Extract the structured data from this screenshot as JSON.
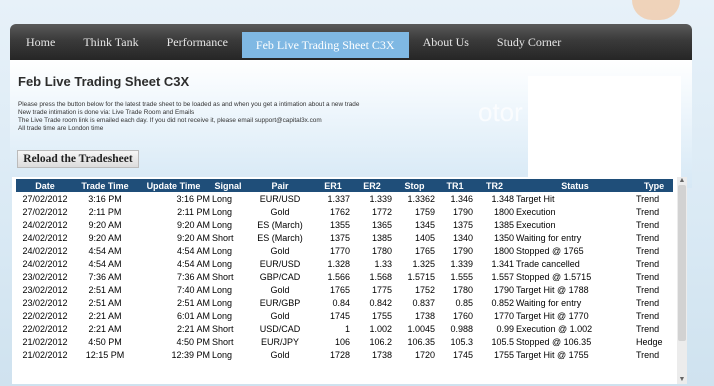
{
  "nav": {
    "items": [
      "Home",
      "Think Tank",
      "Performance",
      "Feb Live Trading Sheet C3X",
      "About Us",
      "Study Corner"
    ],
    "active_index": 3
  },
  "page": {
    "title": "Feb Live Trading Sheet C3X",
    "intro_lines": [
      "Please press the button below for the latest trade sheet to be loaded as and when you get a intimation about a new trade",
      "New trade intimation is done via: Live Trade Room and Emails",
      "The Live Trade room link is emailed each day. If you did not receive it, please email support@capital3x.com",
      "All trade time are London time"
    ],
    "reload_label": "Reload the Tradesheet",
    "watermark": "otor"
  },
  "table": {
    "headers": [
      "Date",
      "Trade Time",
      "Update Time",
      "Signal",
      "Pair",
      "ER1",
      "ER2",
      "Stop",
      "TR1",
      "TR2",
      "Status",
      "Type"
    ],
    "rows": [
      [
        "27/02/2012",
        "3:16 PM",
        "3:16 PM",
        "Long",
        "EUR/USD",
        "1.337",
        "1.339",
        "1.3362",
        "1.346",
        "1.348",
        "Target Hit",
        "Trend"
      ],
      [
        "27/02/2012",
        "2:11 PM",
        "2:11 PM",
        "Long",
        "Gold",
        "1762",
        "1772",
        "1759",
        "1790",
        "1800",
        "Execution",
        "Trend"
      ],
      [
        "24/02/2012",
        "9:20 AM",
        "9:20 AM",
        "Long",
        "ES (March)",
        "1355",
        "1365",
        "1345",
        "1375",
        "1385",
        "Execution",
        "Trend"
      ],
      [
        "24/02/2012",
        "9:20 AM",
        "9:20 AM",
        "Short",
        "ES (March)",
        "1375",
        "1385",
        "1405",
        "1340",
        "1350",
        "Waiting for entry",
        "Trend"
      ],
      [
        "24/02/2012",
        "4:54 AM",
        "4:54 AM",
        "Long",
        "Gold",
        "1770",
        "1780",
        "1765",
        "1790",
        "1800",
        "Stopped @ 1765",
        "Trend"
      ],
      [
        "24/02/2012",
        "4:54 AM",
        "4:54 AM",
        "Long",
        "EUR/USD",
        "1.328",
        "1.33",
        "1.325",
        "1.339",
        "1.341",
        "Trade cancelled",
        "Trend"
      ],
      [
        "23/02/2012",
        "7:36 AM",
        "7:36 AM",
        "Short",
        "GBP/CAD",
        "1.566",
        "1.568",
        "1.5715",
        "1.555",
        "1.557",
        "Stopped @ 1.5715",
        "Trend"
      ],
      [
        "23/02/2012",
        "2:51 AM",
        "7:40 AM",
        "Long",
        "Gold",
        "1765",
        "1775",
        "1752",
        "1780",
        "1790",
        "Target Hit @ 1788",
        "Trend"
      ],
      [
        "23/02/2012",
        "2:51 AM",
        "2:51 AM",
        "Long",
        "EUR/GBP",
        "0.84",
        "0.842",
        "0.837",
        "0.85",
        "0.852",
        "Waiting for entry",
        "Trend"
      ],
      [
        "22/02/2012",
        "2:21 AM",
        "6:01 AM",
        "Long",
        "Gold",
        "1745",
        "1755",
        "1738",
        "1760",
        "1770",
        "Target Hit @ 1770",
        "Trend"
      ],
      [
        "22/02/2012",
        "2:21 AM",
        "2:21 AM",
        "Short",
        "USD/CAD",
        "1",
        "1.002",
        "1.0045",
        "0.988",
        "0.99",
        "Execution @ 1.002",
        "Trend"
      ],
      [
        "21/02/2012",
        "4:50 PM",
        "4:50 PM",
        "Short",
        "EUR/JPY",
        "106",
        "106.2",
        "106.35",
        "105.3",
        "105.5",
        "Stopped @ 106.35",
        "Hedge"
      ],
      [
        "21/02/2012",
        "12:15 PM",
        "12:39 PM",
        "Long",
        "Gold",
        "1728",
        "1738",
        "1720",
        "1745",
        "1755",
        "Target Hit @ 1755",
        "Trend"
      ]
    ]
  },
  "colors": {
    "nav_active": "#7fb8e3",
    "header": "#1f4e79"
  },
  "icons": {
    "scroll_up": "scroll-up-arrow-icon",
    "scroll_down": "scroll-down-arrow-icon"
  }
}
